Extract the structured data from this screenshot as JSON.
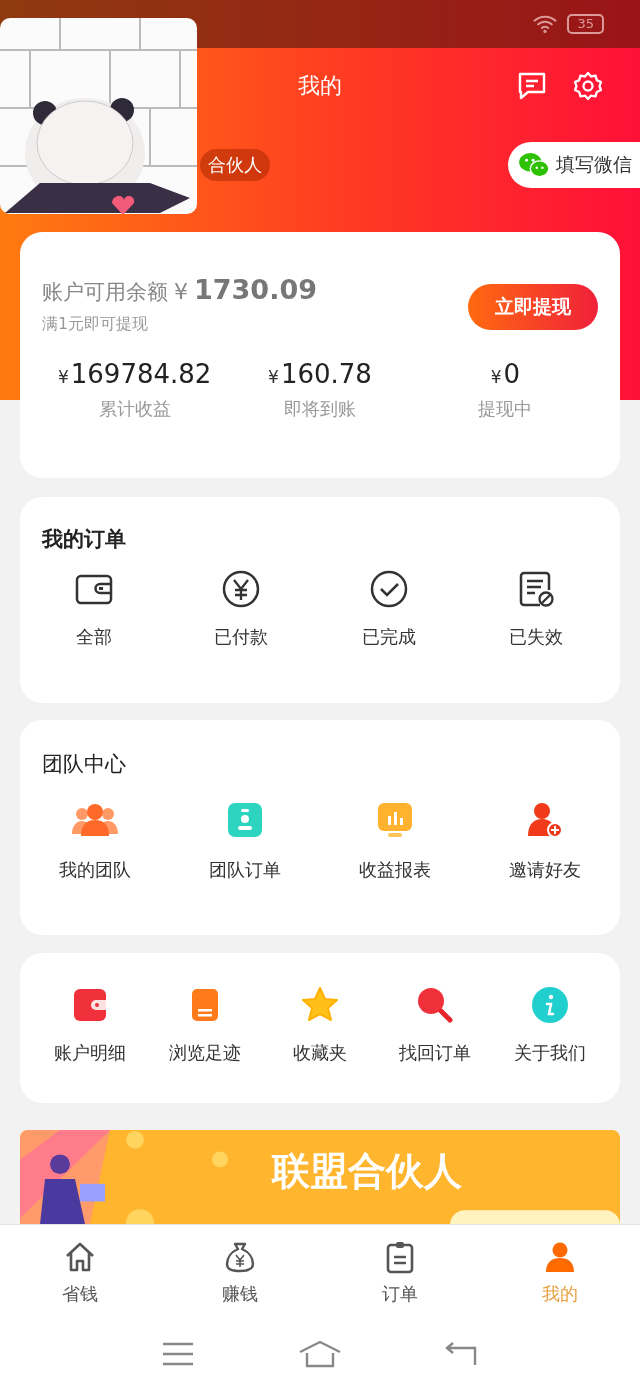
{
  "status_bar": {
    "battery": "35"
  },
  "header": {
    "title": "我的",
    "badge": "合伙人",
    "wechat_button": "填写微信"
  },
  "balance": {
    "label": "账户可用余额",
    "currency": "¥",
    "amount": "1730.09",
    "hint": "满1元即可提现",
    "withdraw_button": "立即提现",
    "stats": [
      {
        "currency": "¥",
        "value": "169784.82",
        "label": "累计收益"
      },
      {
        "currency": "¥",
        "value": "160.78",
        "label": "即将到账"
      },
      {
        "currency": "¥",
        "value": "0",
        "label": "提现中"
      }
    ]
  },
  "orders": {
    "title": "我的订单",
    "items": [
      {
        "label": "全部"
      },
      {
        "label": "已付款"
      },
      {
        "label": "已完成"
      },
      {
        "label": "已失效"
      }
    ]
  },
  "team": {
    "title": "团队中心",
    "items": [
      {
        "label": "我的团队"
      },
      {
        "label": "团队订单"
      },
      {
        "label": "收益报表"
      },
      {
        "label": "邀请好友"
      }
    ]
  },
  "tools": {
    "items": [
      {
        "label": "账户明细"
      },
      {
        "label": "浏览足迹"
      },
      {
        "label": "收藏夹"
      },
      {
        "label": "找回订单"
      },
      {
        "label": "关于我们"
      }
    ]
  },
  "banner": {
    "kind": "picture",
    "title": "联盟合伙人"
  },
  "tabs": [
    {
      "label": "省钱",
      "selected": false
    },
    {
      "label": "赚钱",
      "selected": false
    },
    {
      "label": "订单",
      "selected": false
    },
    {
      "label": "我的",
      "selected": true
    }
  ]
}
